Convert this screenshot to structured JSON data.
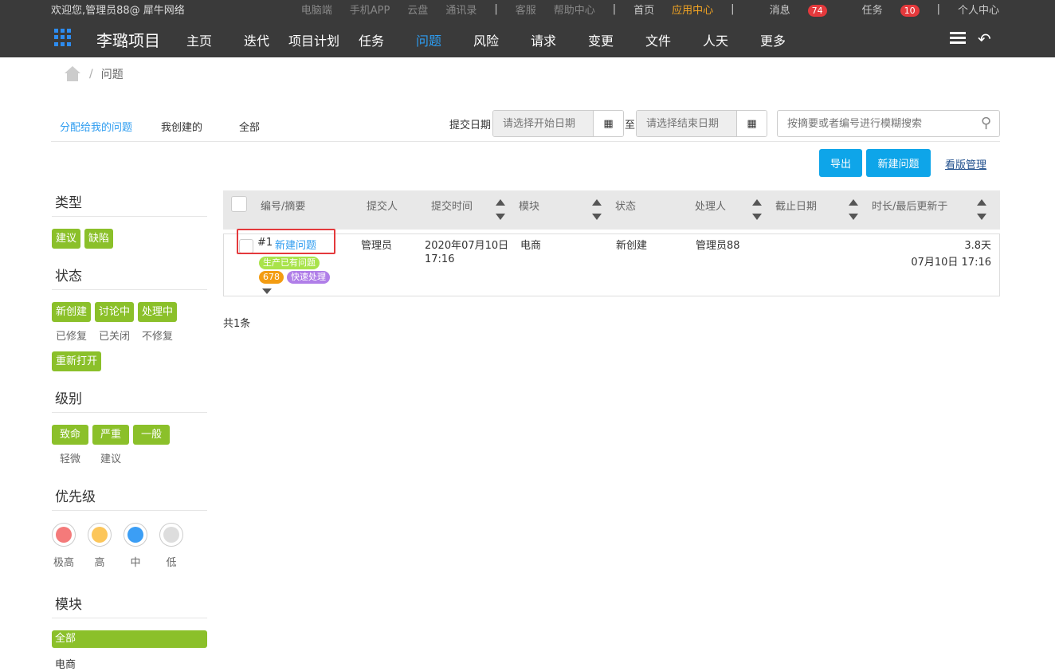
{
  "topbar": {
    "welcome": "欢迎您,管理员88@ 犀牛网络",
    "links": [
      "电脑端",
      "手机APP",
      "云盘",
      "通讯录"
    ],
    "links2": [
      "客服",
      "帮助中心"
    ],
    "home": "首页",
    "app_center": "应用中心",
    "messages": "消息",
    "messages_count": "74",
    "tasks": "任务",
    "tasks_count": "10",
    "personal": "个人中心"
  },
  "nav": {
    "project": "李璐项目",
    "items": [
      "主页",
      "迭代",
      "项目计划",
      "任务",
      "问题",
      "风险",
      "请求",
      "变更",
      "文件",
      "人天",
      "更多"
    ],
    "active": "问题"
  },
  "breadcrumb": {
    "current": "问题"
  },
  "tabs": [
    "分配给我的问题",
    "我创建的",
    "全部"
  ],
  "filter": {
    "date_label": "提交日期",
    "start_placeholder": "请选择开始日期",
    "to": "至",
    "end_placeholder": "请选择结束日期",
    "search_placeholder": "按摘要或者编号进行模糊搜索"
  },
  "actions": {
    "export": "导出",
    "new_issue": "新建问题",
    "board": "看版管理"
  },
  "sidebar": {
    "type_title": "类型",
    "types": [
      "建议",
      "缺陷"
    ],
    "status_title": "状态",
    "status_active": [
      "新创建",
      "讨论中",
      "处理中"
    ],
    "status_plain": [
      "已修复",
      "已关闭",
      "不修复"
    ],
    "status_reopen": "重新打开",
    "level_title": "级别",
    "levels_active": [
      "致命",
      "严重",
      "一般"
    ],
    "levels_plain": [
      "轻微",
      "建议"
    ],
    "priority_title": "优先级",
    "priorities": [
      {
        "label": "极高",
        "color": "#f47a7a"
      },
      {
        "label": "高",
        "color": "#fcc65a"
      },
      {
        "label": "中",
        "color": "#3b9ef5"
      },
      {
        "label": "低",
        "color": "#dddddd"
      }
    ],
    "module_title": "模块",
    "module_all": "全部",
    "module_next": "电商"
  },
  "table": {
    "headers": [
      "编号/摘要",
      "提交人",
      "提交时间",
      "模块",
      "状态",
      "处理人",
      "截止日期",
      "时长/最后更新于"
    ],
    "row": {
      "id": "#1",
      "summary": "新建问题",
      "tag1": "生产已有问题",
      "tag2": "678",
      "tag3": "快速处理",
      "submitter": "管理员",
      "submit_date": "2020年07月10日",
      "submit_time": "17:16",
      "module": "电商",
      "status": "新创建",
      "handler": "管理员88",
      "duration": "3.8天",
      "updated": "07月10日 17:16"
    },
    "footer": "共1条"
  }
}
